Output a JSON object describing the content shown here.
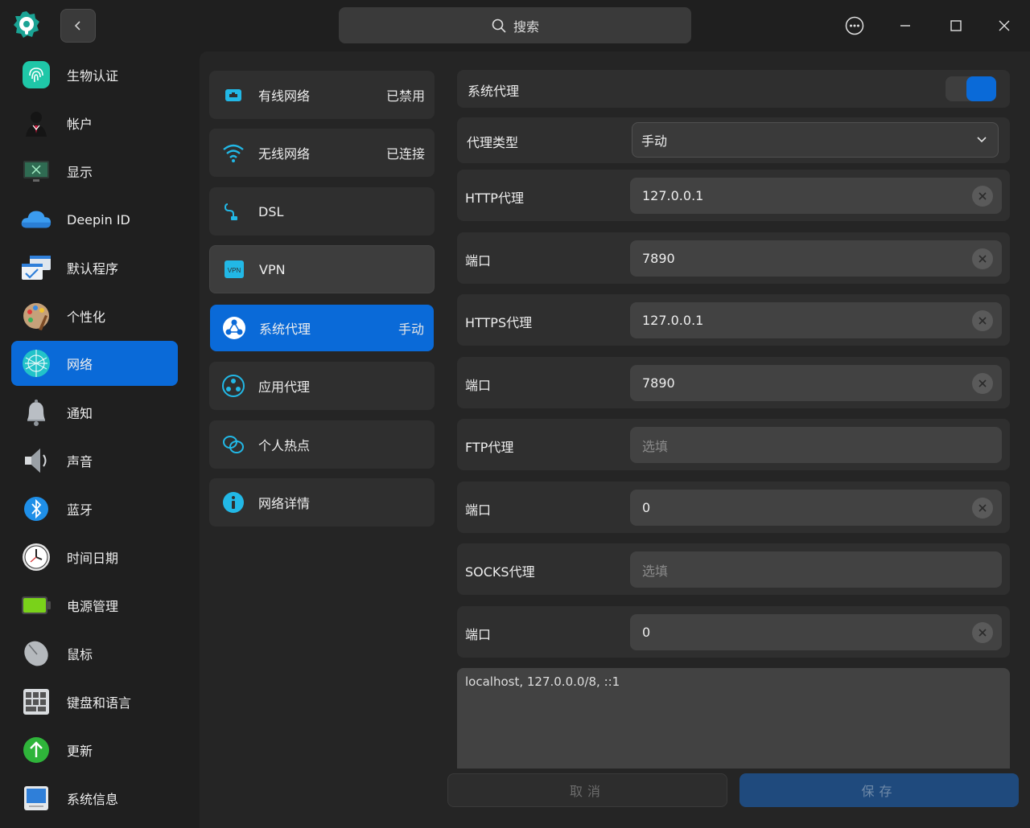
{
  "titlebar": {
    "search_label": "搜索",
    "icons": [
      "back-icon",
      "search-icon",
      "more-icon",
      "minimize-icon",
      "maximize-icon",
      "close-icon"
    ]
  },
  "sidebar": {
    "items": [
      {
        "label": "生物认证",
        "icon": "fingerprint-icon"
      },
      {
        "label": "帐户",
        "icon": "account-icon"
      },
      {
        "label": "显示",
        "icon": "display-icon"
      },
      {
        "label": "Deepin ID",
        "icon": "cloud-icon"
      },
      {
        "label": "默认程序",
        "icon": "default-apps-icon"
      },
      {
        "label": "个性化",
        "icon": "personalization-icon"
      },
      {
        "label": "网络",
        "icon": "network-icon",
        "active": true
      },
      {
        "label": "通知",
        "icon": "bell-icon"
      },
      {
        "label": "声音",
        "icon": "speaker-icon"
      },
      {
        "label": "蓝牙",
        "icon": "bluetooth-icon"
      },
      {
        "label": "时间日期",
        "icon": "clock-icon"
      },
      {
        "label": "电源管理",
        "icon": "battery-icon"
      },
      {
        "label": "鼠标",
        "icon": "mouse-icon"
      },
      {
        "label": "键盘和语言",
        "icon": "keyboard-icon"
      },
      {
        "label": "更新",
        "icon": "update-icon"
      },
      {
        "label": "系统信息",
        "icon": "system-info-icon"
      }
    ]
  },
  "network_menu": {
    "items": [
      {
        "label": "有线网络",
        "status": "已禁用",
        "icon": "wired-icon"
      },
      {
        "label": "无线网络",
        "status": "已连接",
        "icon": "wifi-icon"
      },
      {
        "label": "DSL",
        "status": "",
        "icon": "dsl-icon"
      },
      {
        "label": "VPN",
        "status": "",
        "icon": "vpn-icon",
        "vpn_badge": "VPN"
      },
      {
        "label": "系统代理",
        "status": "手动",
        "icon": "system-proxy-icon",
        "active": true
      },
      {
        "label": "应用代理",
        "status": "",
        "icon": "app-proxy-icon"
      },
      {
        "label": "个人热点",
        "status": "",
        "icon": "hotspot-icon"
      },
      {
        "label": "网络详情",
        "status": "",
        "icon": "info-icon"
      }
    ]
  },
  "proxy": {
    "system_proxy_label": "系统代理",
    "system_proxy_enabled": true,
    "type_label": "代理类型",
    "type_value": "手动",
    "http_label": "HTTP代理",
    "http_value": "127.0.0.1",
    "http_port_label": "端口",
    "http_port_value": "7890",
    "https_label": "HTTPS代理",
    "https_value": "127.0.0.1",
    "https_port_label": "端口",
    "https_port_value": "7890",
    "ftp_label": "FTP代理",
    "ftp_placeholder": "选填",
    "ftp_port_label": "端口",
    "ftp_port_value": "0",
    "socks_label": "SOCKS代理",
    "socks_placeholder": "选填",
    "socks_port_label": "端口",
    "socks_port_value": "0",
    "ignore_hosts": "localhost, 127.0.0.0/8, ::1"
  },
  "footer": {
    "cancel_label": "取消",
    "save_label": "保存"
  },
  "colors": {
    "accent": "#0a6ad8",
    "background": "#1f1f1f",
    "panel": "#2f2f2f",
    "field": "#424242"
  }
}
